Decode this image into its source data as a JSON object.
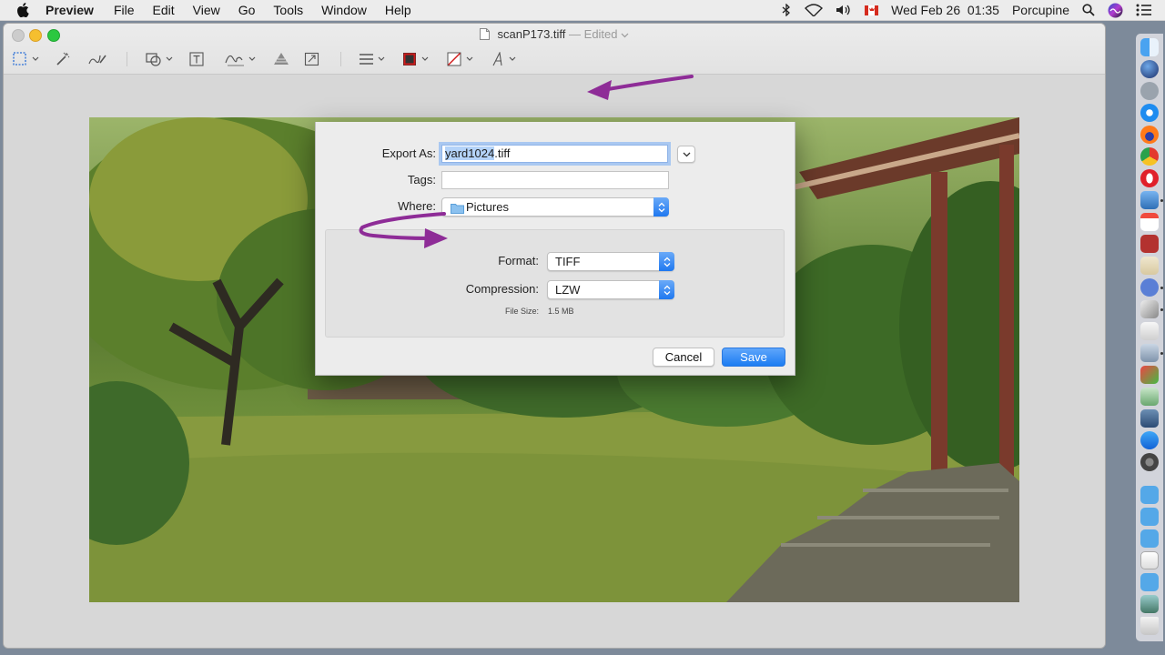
{
  "menubar": {
    "app_name": "Preview",
    "menus": [
      "File",
      "Edit",
      "View",
      "Go",
      "Tools",
      "Window",
      "Help"
    ],
    "datetime": "Wed Feb 26  01:35",
    "user": "Porcupine"
  },
  "window": {
    "filename": "scanP173.tiff",
    "edited_suffix": "— Edited"
  },
  "dialog": {
    "export_as_label": "Export As:",
    "export_as_selected": "yard1024",
    "export_as_ext": ".tiff",
    "tags_label": "Tags:",
    "tags_value": "",
    "where_label": "Where:",
    "where_value": "Pictures",
    "format_label": "Format:",
    "format_value": "TIFF",
    "compression_label": "Compression:",
    "compression_value": "LZW",
    "file_size_label": "File Size:",
    "file_size_value": "1.5 MB",
    "cancel_label": "Cancel",
    "save_label": "Save"
  },
  "colors": {
    "annotation_arrow": "#8e2c97",
    "save_button": "#1c7cf2",
    "accent": "#2a7ae2"
  }
}
